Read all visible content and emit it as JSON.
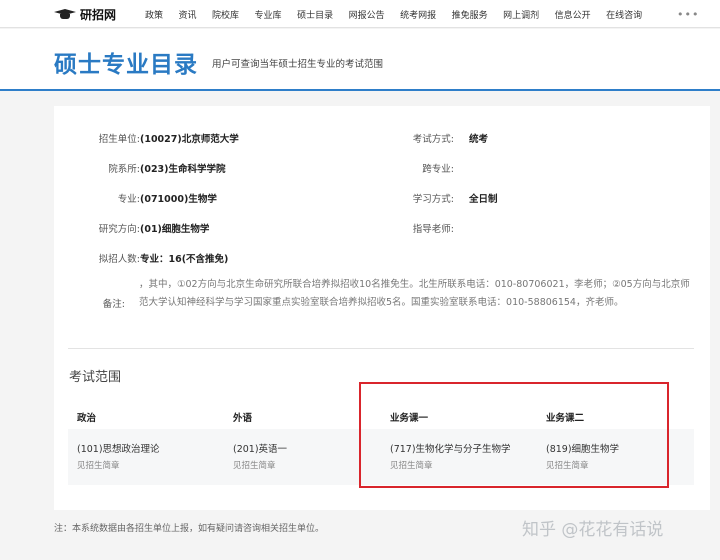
{
  "nav": {
    "logo_text": "研招网",
    "items": [
      "政策",
      "资讯",
      "院校库",
      "专业库",
      "硕士目录",
      "网报公告",
      "统考网报",
      "推免服务",
      "网上调剂",
      "信息公开",
      "在线咨询"
    ],
    "more": "•••"
  },
  "page": {
    "title": "硕士专业目录",
    "subtitle": "用户可查询当年硕士招生专业的考试范围"
  },
  "info": {
    "unit_label": "招生单位:",
    "unit_value": "(10027)北京师范大学",
    "dept_label": "院系所:",
    "dept_value": "(023)生命科学学院",
    "major_label": "专业:",
    "major_value": "(071000)生物学",
    "direction_label": "研究方向:",
    "direction_value": "(01)细胞生物学",
    "quota_label": "拟招人数:",
    "quota_value": "专业：16(不含推免)",
    "exam_mode_label": "考试方式:",
    "exam_mode_value": "统考",
    "cross_label": "跨专业:",
    "cross_value": "",
    "study_mode_label": "学习方式:",
    "study_mode_value": "全日制",
    "advisor_label": "指导老师:",
    "advisor_value": "",
    "note_label": "备注:",
    "note_value": "，其中，①02方向与北京生命研究所联合培养拟招收10名推免生。北生所联系电话：010-80706021，李老师；②05方向与北京师范大学认知神经科学与学习国家重点实验室联合培养拟招收5名。国重实验室联系电话：010-58806154，齐老师。"
  },
  "exam_scope": {
    "title": "考试范围",
    "headers": [
      "政治",
      "外语",
      "业务课一",
      "业务课二"
    ],
    "cells": [
      {
        "name": "(101)思想政治理论",
        "link": "见招生简章"
      },
      {
        "name": "(201)英语一",
        "link": "见招生简章"
      },
      {
        "name": "(717)生物化学与分子生物学",
        "link": "见招生简章"
      },
      {
        "name": "(819)细胞生物学",
        "link": "见招生简章"
      }
    ]
  },
  "footer": {
    "note": "注：本系统数据由各招生单位上报，如有疑问请咨询相关招生单位。"
  },
  "watermark": "知乎 @花花有话说",
  "colors": {
    "accent": "#2a7ac3",
    "highlight": "#d9252c"
  }
}
